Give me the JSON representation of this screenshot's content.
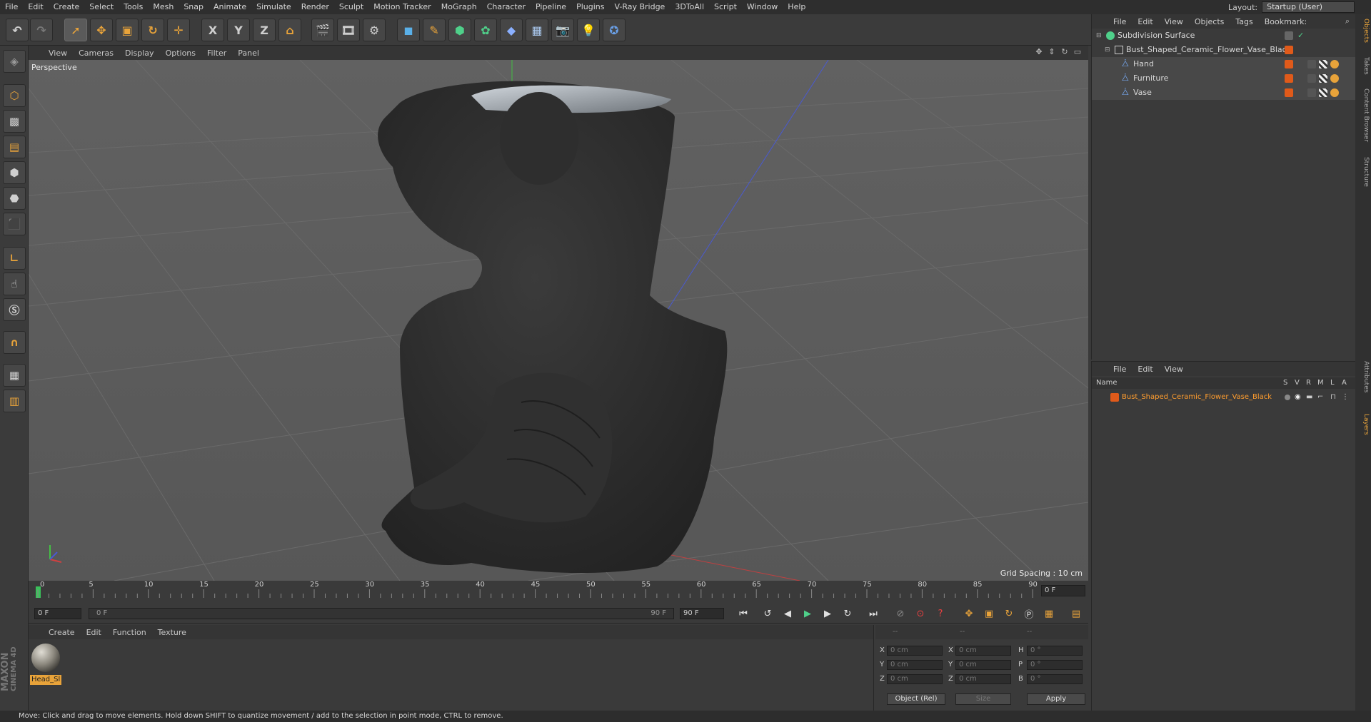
{
  "menubar": {
    "items": [
      "File",
      "Edit",
      "Create",
      "Select",
      "Tools",
      "Mesh",
      "Snap",
      "Animate",
      "Simulate",
      "Render",
      "Sculpt",
      "Motion Tracker",
      "MoGraph",
      "Character",
      "Pipeline",
      "Plugins",
      "V-Ray Bridge",
      "3DToAll",
      "Script",
      "Window",
      "Help"
    ],
    "layout_label": "Layout:",
    "layout_value": "Startup (User)"
  },
  "toolbar": {
    "axis_x": "X",
    "axis_y": "Y",
    "axis_z": "Z"
  },
  "viewport": {
    "menus": [
      "View",
      "Cameras",
      "Display",
      "Options",
      "Filter",
      "Panel"
    ],
    "camera_label": "Perspective",
    "grid_spacing": "Grid Spacing : 10 cm",
    "axis_x": "x",
    "axis_y": "y",
    "axis_z": "z"
  },
  "timeline": {
    "ticks": [
      "0",
      "5",
      "10",
      "15",
      "20",
      "25",
      "30",
      "35",
      "40",
      "45",
      "50",
      "55",
      "60",
      "65",
      "70",
      "75",
      "80",
      "85",
      "90"
    ],
    "current_frame": "0 F",
    "start_frame": "0 F",
    "range_start": "0 F",
    "range_end": "90 F",
    "end_frame": "90 F",
    "right_frame": "0 F"
  },
  "material_panel": {
    "menus": [
      "Create",
      "Edit",
      "Function",
      "Texture"
    ],
    "material_name": "Head_Sl"
  },
  "coordinates": {
    "header": [
      "--",
      "--",
      "--"
    ],
    "rows": [
      {
        "l1": "X",
        "v1": "0 cm",
        "l2": "X",
        "v2": "0 cm",
        "l3": "H",
        "v3": "0 °"
      },
      {
        "l1": "Y",
        "v1": "0 cm",
        "l2": "Y",
        "v2": "0 cm",
        "l3": "P",
        "v3": "0 °"
      },
      {
        "l1": "Z",
        "v1": "0 cm",
        "l2": "Z",
        "v2": "0 cm",
        "l3": "B",
        "v3": "0 °"
      }
    ],
    "mode": "Object (Rel)",
    "size": "Size",
    "apply": "Apply"
  },
  "object_manager": {
    "menus": [
      "File",
      "Edit",
      "View",
      "Objects",
      "Tags",
      "Bookmark:"
    ],
    "objects": [
      {
        "name": "Subdivision Surface",
        "indent": 0
      },
      {
        "name": "Bust_Shaped_Ceramic_Flower_Vase_Black",
        "indent": 1
      },
      {
        "name": "Hand",
        "indent": 2
      },
      {
        "name": "Furniture",
        "indent": 2
      },
      {
        "name": "Vase",
        "indent": 2
      }
    ]
  },
  "layer_manager": {
    "menus": [
      "File",
      "Edit",
      "View"
    ],
    "columns": [
      "Name",
      "S",
      "V",
      "R",
      "M",
      "L",
      "A"
    ],
    "layer_name": "Bust_Shaped_Ceramic_Flower_Vase_Black"
  },
  "right_tabs": [
    "Objects",
    "Takes",
    "Content Browser",
    "Structure",
    "Attributes",
    "Layers"
  ],
  "logo": {
    "line1": "MAXON",
    "line2": "CINEMA 4D"
  },
  "status": "Move: Click and drag to move elements. Hold down SHIFT to quantize movement / add to the selection in point mode, CTRL to remove.",
  "colors": {
    "accent": "#e8a33a",
    "selected": "#ff9d2e",
    "bg": "#3a3a3a",
    "viewport": "#5b5b5b"
  }
}
